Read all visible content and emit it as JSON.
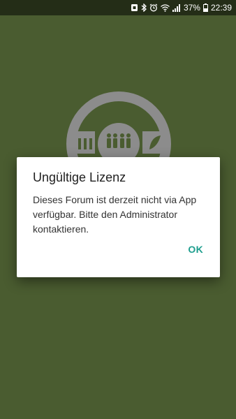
{
  "status_bar": {
    "battery_percent": "37%",
    "time": "22:39",
    "icons": [
      "nfc-icon",
      "bluetooth-icon",
      "alarm-icon",
      "wifi-icon",
      "signal-icon",
      "battery-icon"
    ]
  },
  "background": {
    "color": "#4a5c30",
    "logo_icon": "forum-logo-icon"
  },
  "dialog": {
    "title": "Ungültige Lizenz",
    "message": "Dieses Forum ist derzeit nicht via App verfügbar. Bitte den Administrator kontaktieren.",
    "ok_label": "OK",
    "accent_color": "#1e9e8e"
  }
}
